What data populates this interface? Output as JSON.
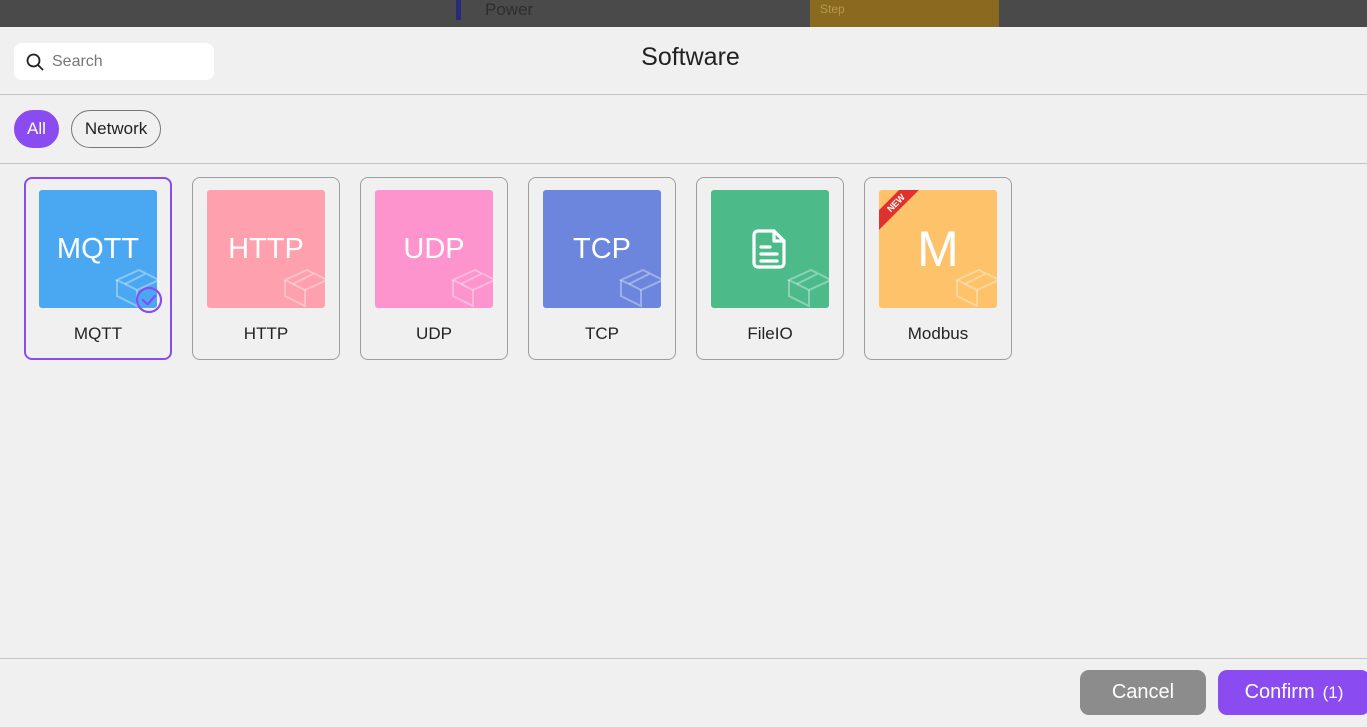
{
  "backdrop": {
    "text": "Power",
    "chip_text": "Step"
  },
  "dialog": {
    "title": "Software",
    "search": {
      "placeholder": "Search",
      "value": ""
    },
    "filters": [
      {
        "label": "All",
        "active": true
      },
      {
        "label": "Network",
        "active": false
      }
    ],
    "cards": [
      {
        "tile_text": "MQTT",
        "label": "MQTT",
        "color": "#4aa8f2",
        "selected": true
      },
      {
        "tile_text": "HTTP",
        "label": "HTTP",
        "color": "#fea0ad",
        "selected": false
      },
      {
        "tile_text": "UDP",
        "label": "UDP",
        "color": "#fe94cd",
        "selected": false
      },
      {
        "tile_text": "TCP",
        "label": "TCP",
        "color": "#6b86dc",
        "selected": false
      },
      {
        "tile_icon": "file-document-icon",
        "label": "FileIO",
        "color": "#4cbb89",
        "selected": false
      },
      {
        "tile_text": "M",
        "label": "Modbus",
        "color": "#fec26a",
        "selected": false,
        "badge": "NEW"
      }
    ],
    "footer": {
      "cancel_label": "Cancel",
      "confirm_label": "Confirm",
      "confirm_count": "(1)"
    },
    "colors": {
      "accent": "#8a4bf1",
      "cancel": "#8c8c8c",
      "badge": "#e0322c"
    }
  }
}
